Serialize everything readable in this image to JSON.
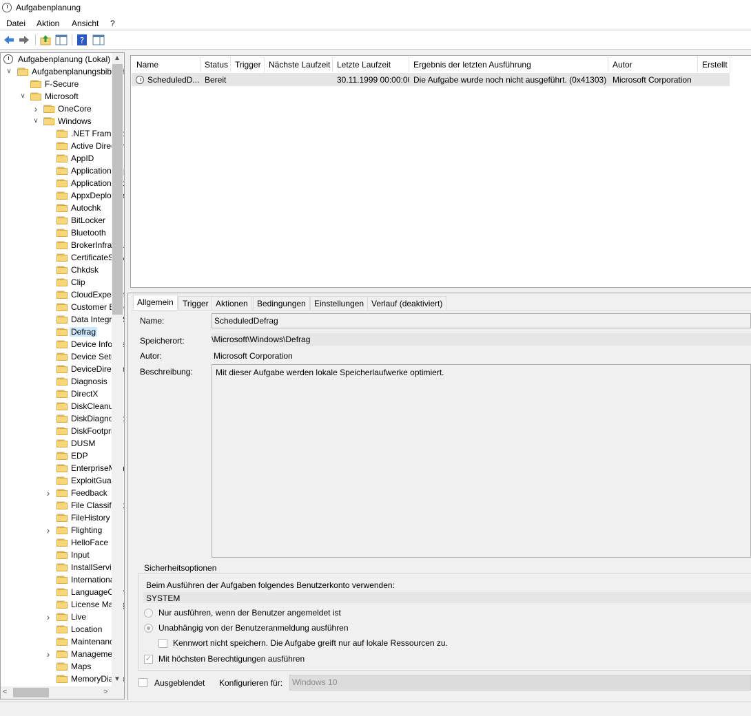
{
  "app": {
    "title": "Aufgabenplanung"
  },
  "menu": [
    "Datei",
    "Aktion",
    "Ansicht",
    "?"
  ],
  "tree": [
    {
      "label": "Aufgabenplanung (Lokal)",
      "depth": 0,
      "icon": "clock-icon",
      "chevron": ""
    },
    {
      "label": "Aufgabenplanungsbibliothek",
      "depth": 0,
      "icon": "folder-clock-icon",
      "chevron": "v"
    },
    {
      "label": "F-Secure",
      "depth": 1,
      "icon": "folder-icon",
      "chevron": ""
    },
    {
      "label": "Microsoft",
      "depth": 1,
      "icon": "folder-icon",
      "chevron": "v"
    },
    {
      "label": "OneCore",
      "depth": 2,
      "icon": "folder-icon",
      "chevron": ">"
    },
    {
      "label": "Windows",
      "depth": 2,
      "icon": "folder-icon",
      "chevron": "v"
    },
    {
      "label": ".NET Framework",
      "depth": 3,
      "icon": "folder-icon",
      "chevron": ""
    },
    {
      "label": "Active Directory",
      "depth": 3,
      "icon": "folder-icon",
      "chevron": ""
    },
    {
      "label": "AppID",
      "depth": 3,
      "icon": "folder-icon",
      "chevron": ""
    },
    {
      "label": "Application Experience",
      "depth": 3,
      "icon": "folder-icon",
      "chevron": ""
    },
    {
      "label": "ApplicationData",
      "depth": 3,
      "icon": "folder-icon",
      "chevron": ""
    },
    {
      "label": "AppxDeploymentClient",
      "depth": 3,
      "icon": "folder-icon",
      "chevron": ""
    },
    {
      "label": "Autochk",
      "depth": 3,
      "icon": "folder-icon",
      "chevron": ""
    },
    {
      "label": "BitLocker",
      "depth": 3,
      "icon": "folder-icon",
      "chevron": ""
    },
    {
      "label": "Bluetooth",
      "depth": 3,
      "icon": "folder-icon",
      "chevron": ""
    },
    {
      "label": "BrokerInfrastructure",
      "depth": 3,
      "icon": "folder-icon",
      "chevron": ""
    },
    {
      "label": "CertificateServicesClient",
      "depth": 3,
      "icon": "folder-icon",
      "chevron": ""
    },
    {
      "label": "Chkdsk",
      "depth": 3,
      "icon": "folder-icon",
      "chevron": ""
    },
    {
      "label": "Clip",
      "depth": 3,
      "icon": "folder-icon",
      "chevron": ""
    },
    {
      "label": "CloudExperienceHost",
      "depth": 3,
      "icon": "folder-icon",
      "chevron": ""
    },
    {
      "label": "Customer Experience",
      "depth": 3,
      "icon": "folder-icon",
      "chevron": ""
    },
    {
      "label": "Data Integrity Scan",
      "depth": 3,
      "icon": "folder-icon",
      "chevron": ""
    },
    {
      "label": "Defrag",
      "depth": 3,
      "icon": "folder-icon",
      "chevron": "",
      "selected": true
    },
    {
      "label": "Device Information",
      "depth": 3,
      "icon": "folder-icon",
      "chevron": ""
    },
    {
      "label": "Device Setup",
      "depth": 3,
      "icon": "folder-icon",
      "chevron": ""
    },
    {
      "label": "DeviceDirectoryClient",
      "depth": 3,
      "icon": "folder-icon",
      "chevron": ""
    },
    {
      "label": "Diagnosis",
      "depth": 3,
      "icon": "folder-icon",
      "chevron": ""
    },
    {
      "label": "DirectX",
      "depth": 3,
      "icon": "folder-icon",
      "chevron": ""
    },
    {
      "label": "DiskCleanup",
      "depth": 3,
      "icon": "folder-icon",
      "chevron": ""
    },
    {
      "label": "DiskDiagnostic",
      "depth": 3,
      "icon": "folder-icon",
      "chevron": ""
    },
    {
      "label": "DiskFootprint",
      "depth": 3,
      "icon": "folder-icon",
      "chevron": ""
    },
    {
      "label": "DUSM",
      "depth": 3,
      "icon": "folder-icon",
      "chevron": ""
    },
    {
      "label": "EDP",
      "depth": 3,
      "icon": "folder-icon",
      "chevron": ""
    },
    {
      "label": "EnterpriseMgmt",
      "depth": 3,
      "icon": "folder-icon",
      "chevron": ""
    },
    {
      "label": "ExploitGuard",
      "depth": 3,
      "icon": "folder-icon",
      "chevron": ""
    },
    {
      "label": "Feedback",
      "depth": 3,
      "icon": "folder-icon",
      "chevron": ">"
    },
    {
      "label": "File Classification",
      "depth": 3,
      "icon": "folder-icon",
      "chevron": ""
    },
    {
      "label": "FileHistory",
      "depth": 3,
      "icon": "folder-icon",
      "chevron": ""
    },
    {
      "label": "Flighting",
      "depth": 3,
      "icon": "folder-icon",
      "chevron": ">"
    },
    {
      "label": "HelloFace",
      "depth": 3,
      "icon": "folder-icon",
      "chevron": ""
    },
    {
      "label": "Input",
      "depth": 3,
      "icon": "folder-icon",
      "chevron": ""
    },
    {
      "label": "InstallService",
      "depth": 3,
      "icon": "folder-icon",
      "chevron": ""
    },
    {
      "label": "International",
      "depth": 3,
      "icon": "folder-icon",
      "chevron": ""
    },
    {
      "label": "LanguageComponentsInstaller",
      "depth": 3,
      "icon": "folder-icon",
      "chevron": ""
    },
    {
      "label": "License Manager",
      "depth": 3,
      "icon": "folder-icon",
      "chevron": ""
    },
    {
      "label": "Live",
      "depth": 3,
      "icon": "folder-icon",
      "chevron": ">"
    },
    {
      "label": "Location",
      "depth": 3,
      "icon": "folder-icon",
      "chevron": ""
    },
    {
      "label": "Maintenance",
      "depth": 3,
      "icon": "folder-icon",
      "chevron": ""
    },
    {
      "label": "Management",
      "depth": 3,
      "icon": "folder-icon",
      "chevron": ">"
    },
    {
      "label": "Maps",
      "depth": 3,
      "icon": "folder-icon",
      "chevron": ""
    },
    {
      "label": "MemoryDiagnostic",
      "depth": 3,
      "icon": "folder-icon",
      "chevron": ""
    }
  ],
  "grid": {
    "columns": [
      "Name",
      "Status",
      "Trigger",
      "Nächste Laufzeit",
      "Letzte Laufzeit",
      "Ergebnis der letzten Ausführung",
      "Autor",
      "Erstellt"
    ],
    "row": {
      "name": "ScheduledD...",
      "status": "Bereit",
      "trigger": "",
      "next": "",
      "last": "30.11.1999 00:00:00",
      "result": "Die Aufgabe wurde noch nicht ausgeführt. (0x41303)",
      "author": "Microsoft Corporation",
      "created": ""
    }
  },
  "tabs": [
    "Allgemein",
    "Trigger",
    "Aktionen",
    "Bedingungen",
    "Einstellungen",
    "Verlauf (deaktiviert)"
  ],
  "general": {
    "name_label": "Name:",
    "name_value": "ScheduledDefrag",
    "location_label": "Speicherort:",
    "location_value": "\\Microsoft\\Windows\\Defrag",
    "author_label": "Autor:",
    "author_value": "Microsoft Corporation",
    "desc_label": "Beschreibung:",
    "desc_value": "Mit dieser Aufgabe werden lokale Speicherlaufwerke optimiert."
  },
  "security": {
    "group_label": "Sicherheitsoptionen",
    "account_prompt": "Beim Ausführen der Aufgaben folgendes Benutzerkonto verwenden:",
    "account_value": "SYSTEM",
    "radio1": "Nur ausführen, wenn der Benutzer angemeldet ist",
    "radio2": "Unabhängig von der Benutzeranmeldung ausführen",
    "check_pw": "Kennwort nicht speichern. Die Aufgabe greift nur auf lokale Ressourcen zu.",
    "check_highest": "Mit höchsten Berechtigungen ausführen"
  },
  "bottom": {
    "hidden_label": "Ausgeblendet",
    "configure_label": "Konfigurieren für:",
    "configure_value": "Windows 10"
  },
  "colors": {
    "selection": "#cce8ff",
    "folder": "#f7d779",
    "help": "#2b57c8"
  }
}
